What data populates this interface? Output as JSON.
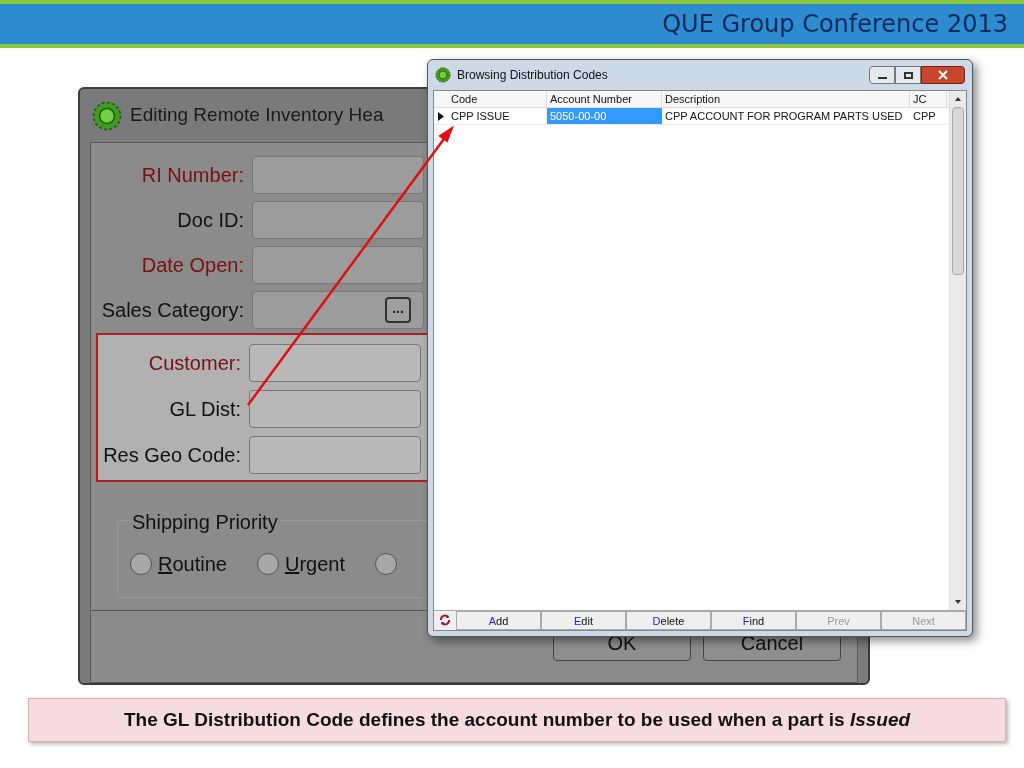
{
  "header": {
    "title": "QUE Group Conference 2013"
  },
  "back_window": {
    "title": "Editing Remote Inventory Hea",
    "fields": [
      {
        "label": "RI Number:",
        "required": true
      },
      {
        "label": "Doc ID:",
        "required": false
      },
      {
        "label": "Date Open:",
        "required": true
      },
      {
        "label": "Sales Category:",
        "required": false,
        "button_text": "..."
      }
    ],
    "highlighted_fields": [
      {
        "label": "Customer:",
        "required": true
      },
      {
        "label": "GL Dist:",
        "required": false
      },
      {
        "label": "Res Geo Code:",
        "required": false
      }
    ],
    "shipping_priority": {
      "title": "Shipping Priority",
      "options": [
        {
          "label": "Routine",
          "selected": false
        },
        {
          "label": "Urgent",
          "selected": false
        },
        {
          "selected": false
        }
      ]
    },
    "buttons": [
      "OK",
      "Cancel"
    ]
  },
  "front_window": {
    "title": "Browsing Distribution Codes",
    "table": {
      "columns": [
        "Code",
        "Account Number",
        "Description",
        "JC"
      ],
      "rows": [
        {
          "current": true,
          "cells": [
            {
              "text": "CPP ISSUE",
              "selected": false
            },
            {
              "text": "5050-00-00",
              "selected": true
            },
            {
              "text": "CPP ACCOUNT FOR PROGRAM PARTS USED",
              "selected": false
            },
            {
              "text": "CPP",
              "selected": false
            }
          ]
        }
      ]
    },
    "nav_buttons": [
      {
        "label": "Add",
        "disabled": false
      },
      {
        "label": "Edit",
        "disabled": false
      },
      {
        "label": "Delete",
        "disabled": false
      },
      {
        "label": "Find",
        "disabled": false
      },
      {
        "label": "Prev",
        "disabled": true
      },
      {
        "label": "Next",
        "disabled": true
      }
    ]
  },
  "caption": "The GL Distribution Code defines the account number to be used when a part is *Issued*"
}
